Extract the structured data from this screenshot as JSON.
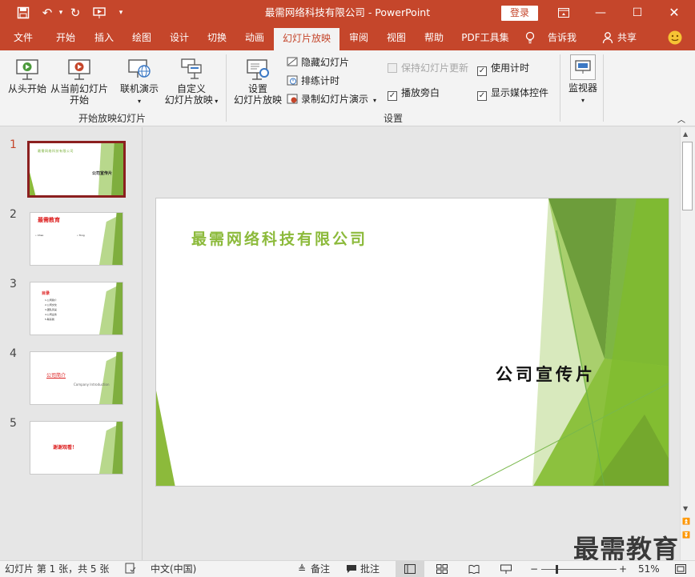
{
  "window": {
    "title": "最需网络科技有限公司 - PowerPoint",
    "login": "登录",
    "colors": {
      "accent": "#c5462b",
      "green": "#8cba3b",
      "dark_green": "#5e8a2e"
    }
  },
  "tabs": [
    "文件",
    "开始",
    "插入",
    "绘图",
    "设计",
    "切换",
    "动画",
    "幻灯片放映",
    "审阅",
    "视图",
    "帮助",
    "PDF工具集",
    "告诉我",
    "共享"
  ],
  "active_tab": "幻灯片放映",
  "ribbon": {
    "group1": {
      "label": "开始放映幻灯片",
      "from_start": "从头开始",
      "from_current_1": "从当前幻灯片",
      "from_current_2": "开始",
      "online_present": "联机演示",
      "custom_show_1": "自定义",
      "custom_show_2": "幻灯片放映"
    },
    "group2": {
      "label": "设置",
      "setup_show_1": "设置",
      "setup_show_2": "幻灯片放映",
      "hide_slide": "隐藏幻灯片",
      "rehearse": "排练计时",
      "record": "录制幻灯片演示",
      "keep_updated": "保持幻灯片更新",
      "play_narrations": "播放旁白",
      "use_timings": "使用计时",
      "show_media_controls": "显示媒体控件"
    },
    "group3": {
      "monitor": "监视器"
    }
  },
  "slides": [
    {
      "num": "1",
      "title": "最需网络科技有限公司",
      "subtitle": "公司宣传片"
    },
    {
      "num": "2",
      "title": "最需教育",
      "left": "• Chao",
      "right": "• Tong"
    },
    {
      "num": "3",
      "title": "目录",
      "items": [
        "1.公司简介",
        "2.公司文化",
        "3.团队风采",
        "4.公司业务",
        "5.联系我"
      ]
    },
    {
      "num": "4",
      "title": "公司简介",
      "subtitle": "Company Introduction"
    },
    {
      "num": "5",
      "title": "谢谢观看！"
    }
  ],
  "main_slide": {
    "title": "最需网络科技有限公司",
    "subtitle": "公司宣传片"
  },
  "status": {
    "slide_info": "幻灯片 第 1 张，共 5 张",
    "language": "中文(中国)",
    "notes": "备注",
    "comments": "批注",
    "zoom": "51%",
    "watermark": "最需教育"
  }
}
